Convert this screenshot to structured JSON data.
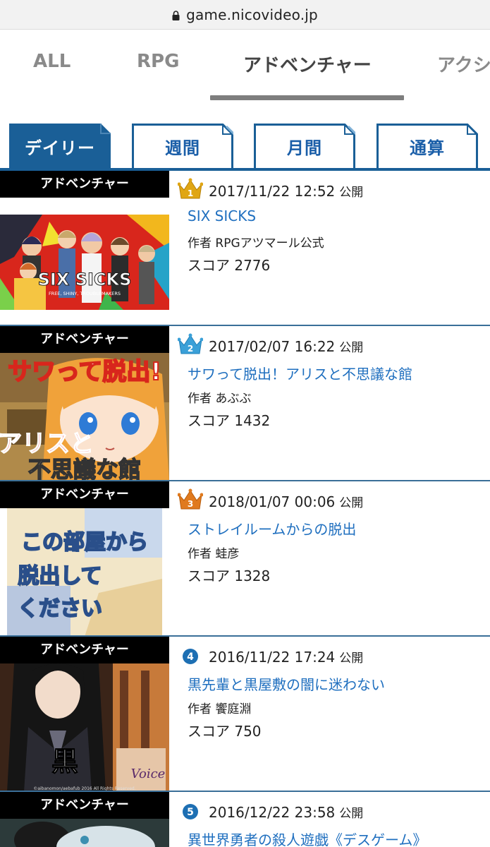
{
  "browser": {
    "url": "game.nicovideo.jp",
    "lock_icon": "lock-icon"
  },
  "category_tabs": [
    {
      "label": "ALL",
      "active": false
    },
    {
      "label": "RPG",
      "active": false
    },
    {
      "label": "アドベンチャー",
      "active": true
    },
    {
      "label": "アクシ",
      "active": false
    }
  ],
  "period_tabs": [
    {
      "label": "デイリー",
      "active": true
    },
    {
      "label": "週間",
      "active": false
    },
    {
      "label": "月間",
      "active": false
    },
    {
      "label": "通算",
      "active": false
    }
  ],
  "publish_suffix": "公開",
  "author_prefix": "作者",
  "score_prefix": "スコア",
  "colors": {
    "accent_blue": "#1a5f97",
    "link_blue": "#1f6fbf",
    "gold": "#e0a614",
    "silver_blue": "#3aa0d8",
    "bronze": "#e07a1e",
    "rank_badge_blue": "#1d6fb3"
  },
  "rankings": [
    {
      "rank": "1",
      "rank_icon": "gold-crown-icon",
      "genre": "アドベンチャー",
      "date": "2017/11/22 12:52",
      "title": "SIX SICKS",
      "author": "RPGアツマール公式",
      "score": "2776",
      "thumb_title": "SIX SICKS",
      "thumb_sub": "FREE, SHINY, TROUBLEMAKERS"
    },
    {
      "rank": "2",
      "rank_icon": "silver-crown-icon",
      "genre": "アドベンチャー",
      "date": "2017/02/07 16:22",
      "title": "サワって脱出！アリスと不思議な館",
      "author": "あぶぶ",
      "score": "1432",
      "thumb_text_top": "サワって脱出!",
      "thumb_text_mid": "アリスと",
      "thumb_text_bottom": "不思議な館"
    },
    {
      "rank": "3",
      "rank_icon": "bronze-crown-icon",
      "genre": "アドベンチャー",
      "date": "2018/01/07 00:06",
      "title": "ストレイルームからの脱出",
      "author": "蛙彦",
      "score": "1328",
      "thumb_lines": [
        "この部屋から",
        "脱出して",
        "ください"
      ]
    },
    {
      "rank": "4",
      "rank_icon": "rank-4-badge-icon",
      "genre": "アドベンチャー",
      "date": "2016/11/22 17:24",
      "title": "黒先輩と黒屋敷の闇に迷わない",
      "author": "饗庭淵",
      "score": "750",
      "thumb_kanji": "黒",
      "thumb_voice": "Voice",
      "thumb_copy": "©aibanomon/aebafub 2016 All Rights Reserved."
    },
    {
      "rank": "5",
      "rank_icon": "rank-5-badge-icon",
      "genre": "アドベンチャー",
      "date": "2016/12/22 23:58",
      "title": "異世界勇者の殺人遊戯《デスゲーム》",
      "author": "",
      "score": ""
    }
  ]
}
